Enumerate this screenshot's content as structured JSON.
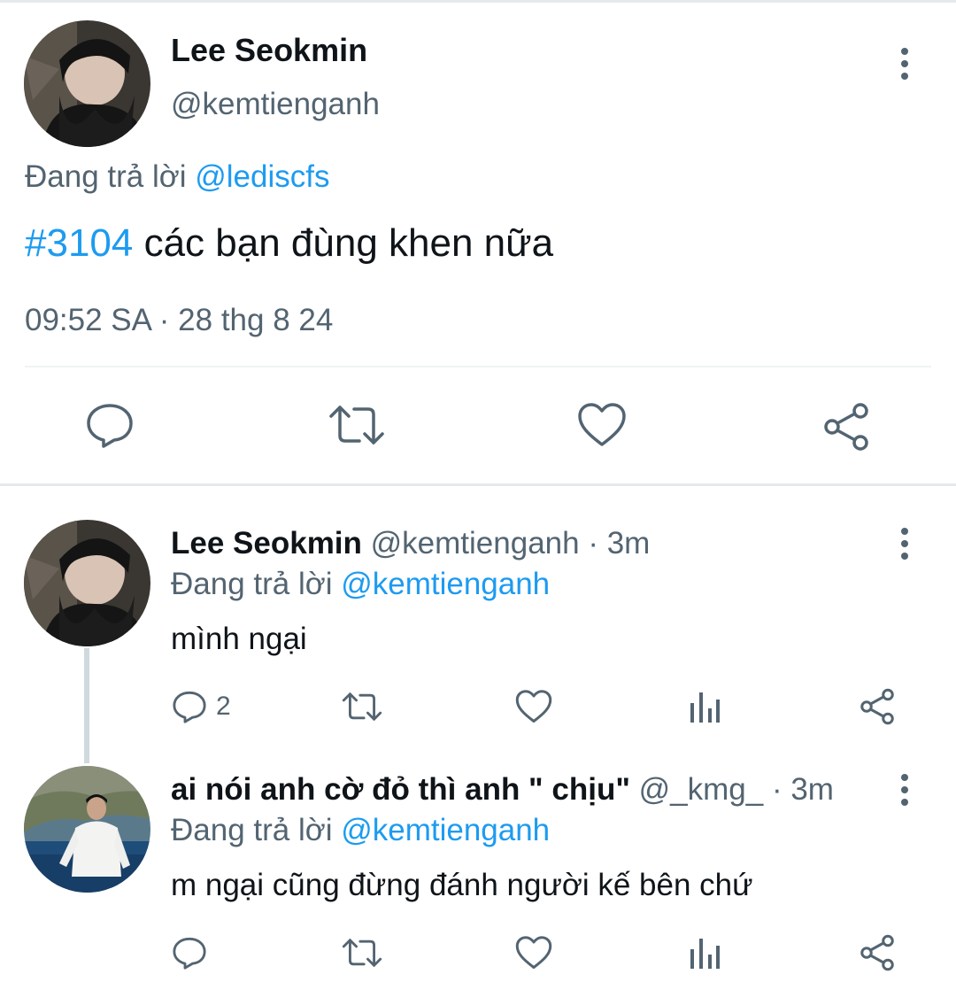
{
  "main_tweet": {
    "avatar_icon": "user-avatar-photo",
    "name": "Lee Seokmin",
    "handle": "@kemtienganh",
    "reply_prefix": "Đang trả lời ",
    "reply_to": "@lediscfs",
    "hashtag": "#3104",
    "text": " các bạn đùng khen nữa",
    "timestamp": "09:52 SA · 28 thg 8 24",
    "actions": [
      "reply-icon",
      "retweet-icon",
      "like-icon",
      "share-icon"
    ]
  },
  "replies": [
    {
      "name": "Lee Seokmin",
      "handle_time": " @kemtienganh · 3m",
      "reply_prefix": "Đang trả lời ",
      "reply_to": "@kemtienganh",
      "text": "mình ngại",
      "reply_count": "2"
    },
    {
      "name": "ai nói anh cờ đỏ thì anh \" chịu\"",
      "handle_time": " @_kmg_ · 3m",
      "reply_prefix": "Đang trả lời ",
      "reply_to": "@kemtienganh",
      "text": "m ngại cũng đừng đánh người kế bên chứ",
      "reply_count": ""
    }
  ],
  "colors": {
    "accent": "#1d9bf0",
    "text": "#0f1419",
    "secondary": "#536471",
    "divider": "#eff3f4"
  }
}
